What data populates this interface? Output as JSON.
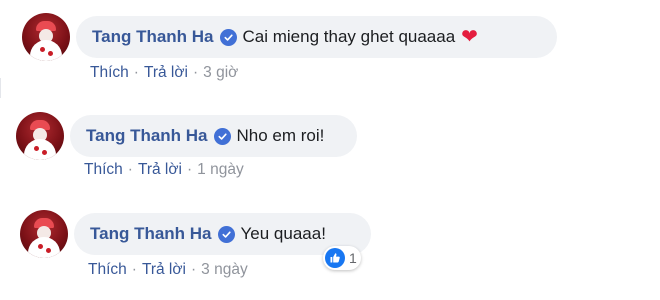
{
  "comments": [
    {
      "author": "Tang Thanh Ha",
      "text": "Cai mieng thay ghet quaaaa",
      "emoji": "❤",
      "like_label": "Thích",
      "reply_label": "Trả lời",
      "separator": "·",
      "time": "3 giờ"
    },
    {
      "author": "Tang Thanh Ha",
      "text": "Nho em roi!",
      "like_label": "Thích",
      "reply_label": "Trả lời",
      "separator": "·",
      "time": "1 ngày"
    },
    {
      "author": "Tang Thanh Ha",
      "text": "Yeu quaaa!",
      "like_label": "Thích",
      "reply_label": "Trả lời",
      "separator": "·",
      "time": "3 ngày",
      "reaction": {
        "icon": "like-icon",
        "count": "1"
      }
    }
  ],
  "colors": {
    "author": "#385898",
    "bubble": "#f0f2f5",
    "verified": "#4170d6",
    "heart": "#e41e3f",
    "like": "#1877f2"
  }
}
